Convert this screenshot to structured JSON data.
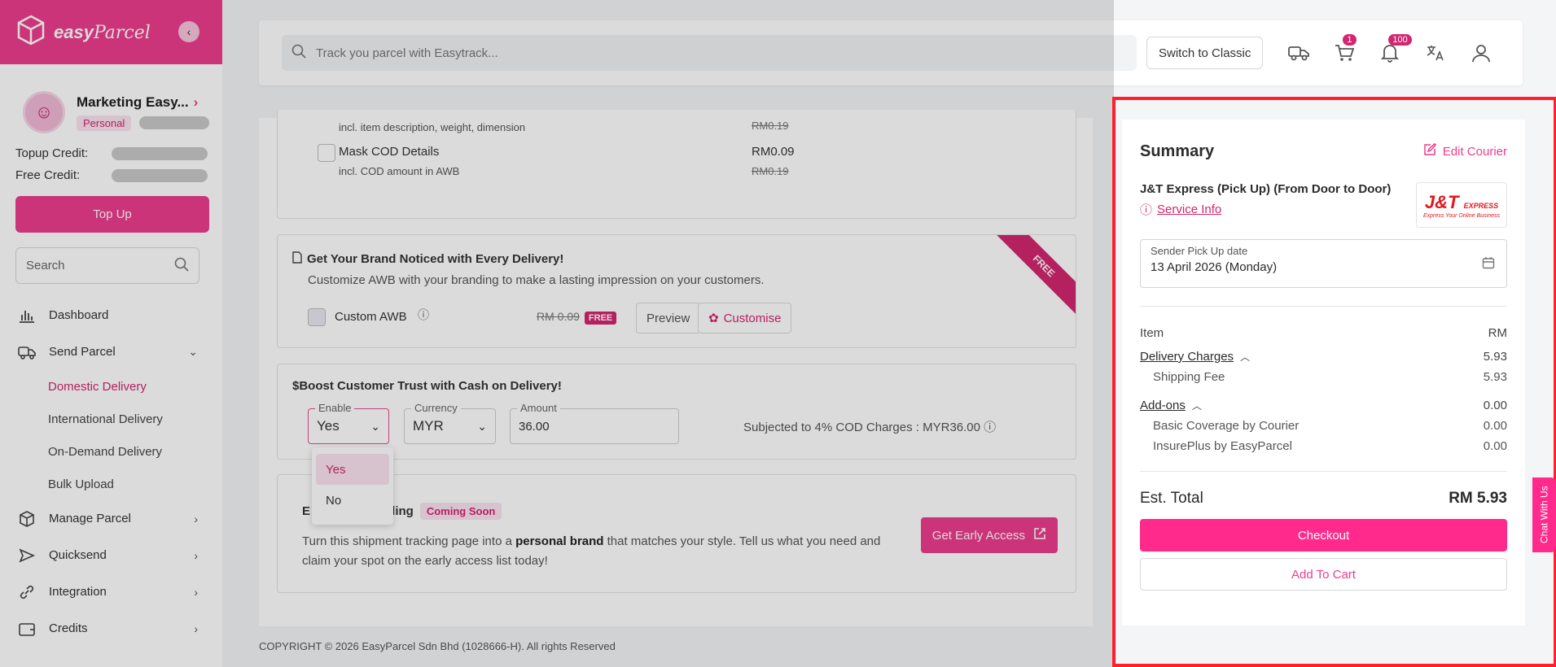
{
  "brand": {
    "name_bold": "easy",
    "name_italic": "Parcel"
  },
  "profile": {
    "name": "Marketing Easy...",
    "tag": "Personal"
  },
  "credits": {
    "topup_label": "Topup Credit:",
    "free_label": "Free Credit:",
    "topup_button": "Top Up"
  },
  "sidebar_search": {
    "placeholder": "Search"
  },
  "nav": {
    "dashboard": "Dashboard",
    "send_parcel": "Send Parcel",
    "sub": [
      "Domestic Delivery",
      "International Delivery",
      "On-Demand Delivery",
      "Bulk Upload"
    ],
    "manage_parcel": "Manage Parcel",
    "quicksend": "Quicksend",
    "integration": "Integration",
    "credits": "Credits"
  },
  "topbar": {
    "search_placeholder": "Track you parcel with Easytrack...",
    "switch_classic": "Switch to Classic",
    "cart_badge": "1",
    "notif_badge": "100"
  },
  "addons": {
    "item_desc": "incl. item description, weight, dimension",
    "item_price_old": "RM0.19",
    "mask_cod_title": "Mask COD Details",
    "mask_cod_desc": "incl. COD amount in AWB",
    "mask_cod_price": "RM0.09",
    "mask_cod_price_old": "RM0.19"
  },
  "branding": {
    "title": "Get Your Brand Noticed with Every Delivery!",
    "desc": "Customize AWB with your branding to make a lasting impression on your customers.",
    "custom_awb": "Custom AWB",
    "price_old": "RM 0.09",
    "free_tag": "FREE",
    "preview": "Preview",
    "customise": "Customise",
    "ribbon": "FREE"
  },
  "cod": {
    "title": "Boost Customer Trust with Cash on Delivery!",
    "enable_label": "Enable",
    "enable_value": "Yes",
    "currency_label": "Currency",
    "currency_value": "MYR",
    "amount_label": "Amount",
    "amount_value": "36.00",
    "note": "Subjected to 4% COD Charges : MYR36.00",
    "options": [
      "Yes",
      "No"
    ]
  },
  "tracking": {
    "title_prefix": "E",
    "title_suffix": "nding",
    "coming": "Coming Soon",
    "desc_1": "Turn this shipment tracking page into a ",
    "desc_bold": "personal brand",
    "desc_2": " that matches your style. Tell us what you need and claim your spot on the early access list today!",
    "button": "Get Early Access"
  },
  "copyright": "COPYRIGHT © 2026 EasyParcel Sdn Bhd (1028666-H). All rights Reserved",
  "summary": {
    "title": "Summary",
    "edit_courier": "Edit Courier",
    "courier_name": "J&T Express (Pick Up) (From Door to Door)",
    "service_info": "Service Info",
    "logo_big": "J&T",
    "logo_express": "EXPRESS",
    "logo_tagline": "Express Your Online Business",
    "date_label": "Sender Pick Up date",
    "date_value": "13 April 2026 (Monday)",
    "item_label": "Item",
    "currency": "RM",
    "delivery_charges": "Delivery Charges",
    "delivery_charges_value": "5.93",
    "shipping_fee": "Shipping Fee",
    "shipping_fee_value": "5.93",
    "addons": "Add-ons",
    "addons_value": "0.00",
    "basic_coverage": "Basic Coverage by Courier",
    "basic_coverage_value": "0.00",
    "insureplus": "InsurePlus by EasyParcel",
    "insureplus_value": "0.00",
    "est_total": "Est. Total",
    "est_total_value": "RM 5.93",
    "checkout": "Checkout",
    "add_to_cart": "Add To Cart"
  },
  "chat": "Chat With Us",
  "colors": {
    "brand_pink": "#ee3d8f",
    "highlight_red": "#ff1f2d",
    "checkout_pink": "#ff2a8b"
  }
}
